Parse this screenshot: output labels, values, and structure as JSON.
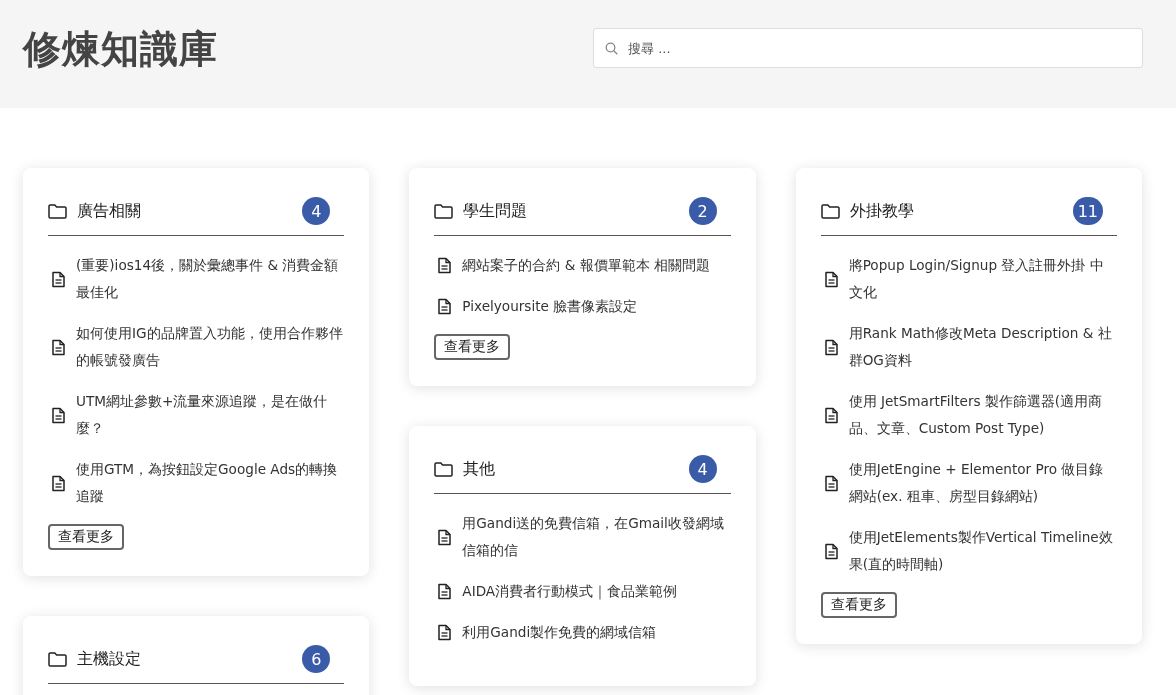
{
  "site_title": "修煉知識庫",
  "search": {
    "placeholder": "搜尋 ..."
  },
  "columns": [
    {
      "cards": [
        {
          "title": "廣告相關",
          "count": "4",
          "items": [
            "(重要)ios14後，關於彙總事件 & 消費金額最佳化",
            "如何使用IG的品牌置入功能，使用合作夥伴的帳號發廣告",
            "UTM網址參數+流量來源追蹤，是在做什麼？",
            "使用GTM，為按鈕設定Google Ads的轉換追蹤"
          ],
          "more": "查看更多"
        },
        {
          "title": "主機設定",
          "count": "6"
        }
      ]
    },
    {
      "cards": [
        {
          "title": "學生問題",
          "count": "2",
          "items": [
            "網站案子的合約 & 報價單範本 相關問題",
            "Pixelyoursite 臉書像素設定"
          ],
          "more": "查看更多"
        },
        {
          "title": "其他",
          "count": "4",
          "items": [
            "用Gandi送的免費信箱，在Gmail收發網域信箱的信",
            "AIDA消費者行動模式｜食品業範例",
            "利用Gandi製作免費的網域信箱"
          ]
        }
      ]
    },
    {
      "cards": [
        {
          "title": "外掛教學",
          "count": "11",
          "items": [
            "將Popup Login/Signup 登入註冊外掛 中文化",
            "用Rank Math修改Meta Description & 社群OG資料",
            "使用 JetSmartFilters 製作篩選器(適用商品、文章、Custom Post Type)",
            "使用JetEngine + Elementor Pro 做目錄網站(ex. 租車、房型目錄網站)",
            "使用JetElements製作Vertical Timeline效果(直的時間軸)"
          ],
          "more": "查看更多"
        }
      ]
    }
  ]
}
